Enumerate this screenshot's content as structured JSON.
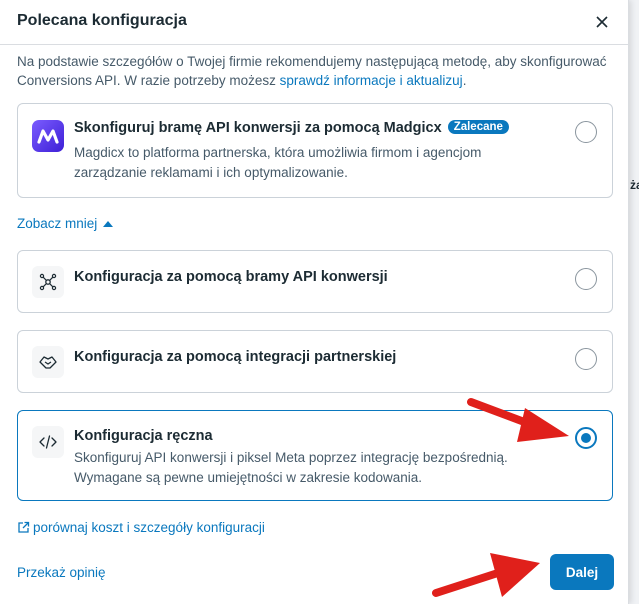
{
  "dialog": {
    "title": "Polecana konfiguracja",
    "intro_text": "Na podstawie szczegółów o Twojej firmie rekomendujemy następującą metodę, aby skonfigurować Conversions API. W razie potrzeby możesz ",
    "intro_link": "sprawdź informacje i aktualizuj",
    "intro_end": "."
  },
  "recommended": {
    "title": "Skonfiguruj bramę API konwersji za pomocą Madgicx",
    "badge": "Zalecane",
    "description": "Magdicx to platforma partnerska, która umożliwia firmom i agencjom zarządzanie reklamami i ich optymalizowanie.",
    "icon": "madgicx-logo"
  },
  "toggle_label": "Zobacz mniej",
  "options": [
    {
      "title": "Konfiguracja za pomocą bramy API konwersji",
      "icon": "gateway-network-icon",
      "selected": false
    },
    {
      "title": "Konfiguracja za pomocą integracji partnerskiej",
      "icon": "handshake-icon",
      "selected": false
    },
    {
      "title": "Konfiguracja ręczna",
      "description": "Skonfiguruj API konwersji i piksel Meta poprzez integrację bezpośrednią. Wymagane są pewne umiejętności w zakresie kodowania.",
      "icon": "code-icon",
      "selected": true
    }
  ],
  "compare_link": "porównaj koszt i szczegóły konfiguracji",
  "feedback_link": "Przekaż opinię",
  "next_button": "Dalej",
  "background_fragments": [
    "ża"
  ],
  "colors": {
    "accent": "#0a78be",
    "annotation_arrow": "#e0201b"
  }
}
